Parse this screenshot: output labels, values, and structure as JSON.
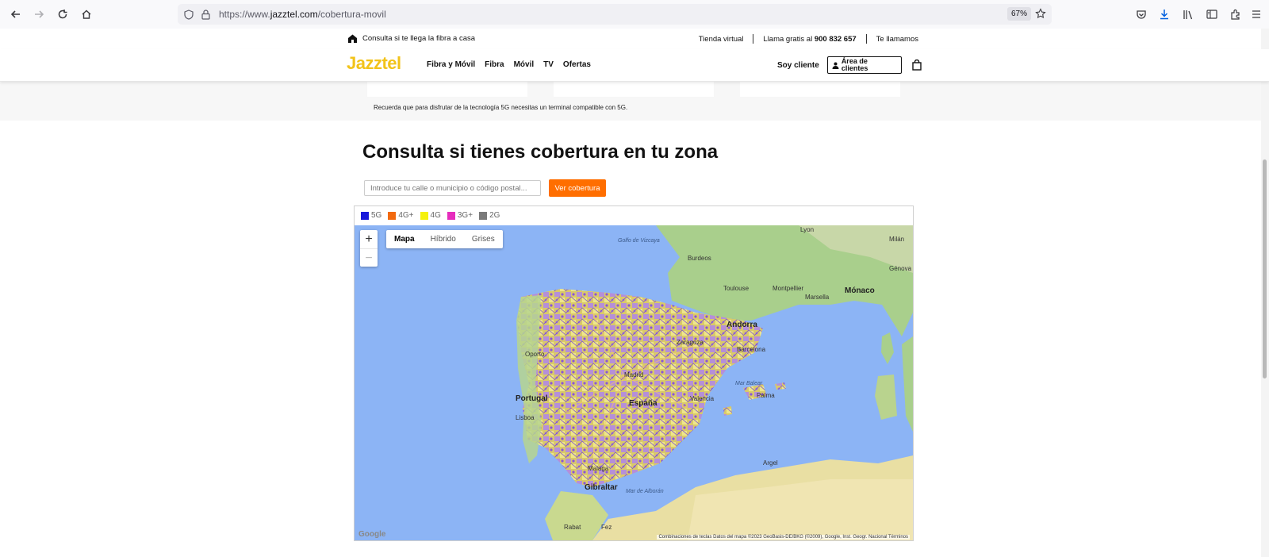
{
  "browser": {
    "url_prefix": "https://www.",
    "url_domain": "jazztel.com",
    "url_path": "/cobertura-movil",
    "zoom": "67%"
  },
  "topbar": {
    "fiber_check": "Consulta si te llega la fibra a casa",
    "store": "Tienda virtual",
    "call_prefix": "Llama gratis al",
    "phone": "900 832 657",
    "callback": "Te llamamos"
  },
  "nav": {
    "logo": "Jazztel",
    "links": [
      "Fibra y Móvil",
      "Fibra",
      "Móvil",
      "TV",
      "Ofertas"
    ],
    "soy_cliente": "Soy cliente",
    "area_clientes": "Área de clientes"
  },
  "band": {
    "note": "Recuerda que para disfrutar de la tecnología 5G necesitas un terminal compatible con 5G."
  },
  "coverage": {
    "title": "Consulta si tienes cobertura en tu zona",
    "search_placeholder": "Introduce tu calle o municipio o código postal...",
    "search_button": "Ver cobertura"
  },
  "legend": [
    {
      "label": "5G",
      "color": "#1a1adb"
    },
    {
      "label": "4G+",
      "color": "#f26a0f"
    },
    {
      "label": "4G",
      "color": "#f5f10d"
    },
    {
      "label": "3G+",
      "color": "#e62dbd"
    },
    {
      "label": "2G",
      "color": "#7a7a7a"
    }
  ],
  "map": {
    "types": [
      "Mapa",
      "Híbrido",
      "Grises"
    ],
    "labels": {
      "portugal": "Portugal",
      "espana": "España",
      "andorra": "Andorra",
      "monaco": "Mónaco",
      "gibraltar": "Gibraltar",
      "madrid": "Madrid",
      "barcelona": "Barcelona",
      "valencia": "Valencia",
      "zaragoza": "Zaragoza",
      "lisboa": "Lisboa",
      "oporto": "Oporto",
      "malaga": "Malaga",
      "toulouse": "Toulouse",
      "montpellier": "Montpellier",
      "marsella": "Marsella",
      "lyon": "Lyon",
      "bordeaux": "Burdeos",
      "argel": "Argel",
      "rabat": "Rabat",
      "fez": "Fez",
      "palma": "Palma",
      "genova": "Génova",
      "milan": "Milán",
      "golfo": "Golfo de Vizcaya",
      "mar_alboran": "Mar de Alborán",
      "mar_balear": "Mar Balear"
    },
    "footer": "Combinaciones de teclas   Datos del mapa ©2023 GeoBasis-DE/BKG (©2009), Google, Inst. Geogr. Nacional   Términos",
    "google": "Google",
    "zoom_in": "+",
    "zoom_out": "−"
  }
}
